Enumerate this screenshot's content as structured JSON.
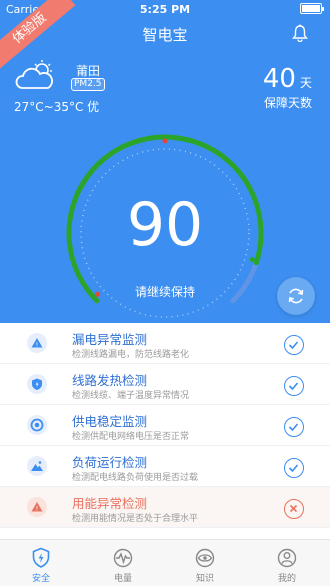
{
  "status_bar": {
    "carrier": "Carrier",
    "time": "5:25 PM"
  },
  "ribbon": "体验版",
  "header": {
    "title": "智电宝"
  },
  "weather": {
    "city": "莆田",
    "pm_badge": "PM2.5",
    "temperature": "27°C~35°C 优"
  },
  "protection": {
    "days": "40",
    "unit": "天",
    "label": "保障天数"
  },
  "gauge": {
    "score": "90",
    "message": "请继续保持",
    "level": 0.9
  },
  "checks": [
    {
      "name": "漏电异常监测",
      "desc": "检测线路漏电，防范线路老化",
      "status": "ok"
    },
    {
      "name": "线路发热检测",
      "desc": "检测线缆、端子温度异常情况",
      "status": "ok"
    },
    {
      "name": "供电稳定监测",
      "desc": "检测供配电网络电压是否正常",
      "status": "ok"
    },
    {
      "name": "负荷运行检测",
      "desc": "检测配电线路负荷使用是否过载",
      "status": "ok"
    },
    {
      "name": "用能异常检测",
      "desc": "检测用能情况是否处于合理水平",
      "status": "error"
    }
  ],
  "tabs": [
    {
      "label": "安全",
      "icon": "shield-bolt-icon",
      "active": true
    },
    {
      "label": "电量",
      "icon": "pulse-icon",
      "active": false
    },
    {
      "label": "知识",
      "icon": "eye-icon",
      "active": false
    },
    {
      "label": "我的",
      "icon": "person-icon",
      "active": false
    }
  ],
  "colors": {
    "primary": "#3c8ef0",
    "gauge_green": "#2aa52a",
    "warning": "#e9715f",
    "gauge_track": "#5f94e6"
  }
}
